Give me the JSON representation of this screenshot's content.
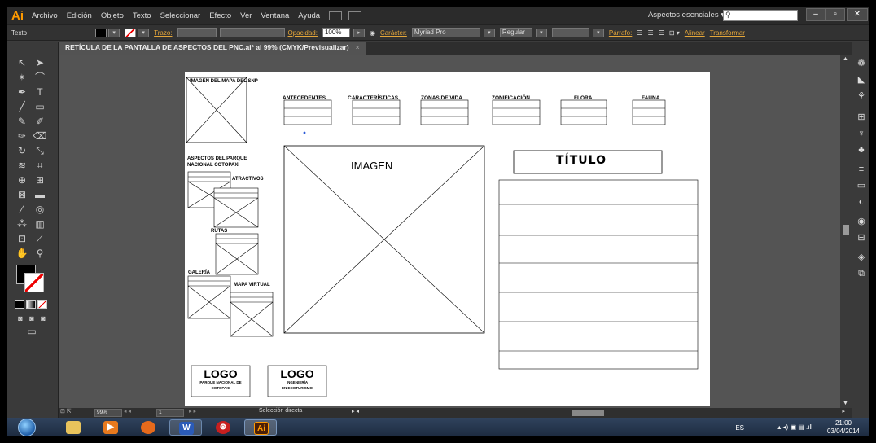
{
  "app": {
    "logo": "Ai",
    "menus": [
      "Archivo",
      "Edición",
      "Objeto",
      "Texto",
      "Seleccionar",
      "Efecto",
      "Ver",
      "Ventana",
      "Ayuda"
    ],
    "workspace": "Aspectos esenciales",
    "window_buttons": [
      "–",
      "▫",
      "✕"
    ]
  },
  "control_bar": {
    "tool_label": "Texto",
    "stroke_label": "Trazo:",
    "opacity_label": "Opacidad:",
    "opacity_value": "100%",
    "character_label": "Carácter:",
    "font_name": "Myriad Pro",
    "font_style": "Regular",
    "paragraph_label": "Párrafo:",
    "align_label": "Alinear",
    "transform_label": "Transformar"
  },
  "document": {
    "tab_title": "RETÍCULA DE LA PANTALLA DE ASPECTOS DEL PNC.ai* al 99% (CMYK/Previsualizar)",
    "tab_close": "×"
  },
  "artboard": {
    "map_label": "IMAGEN DEL MAPA DEL SNP",
    "nav": [
      "ANTECEDENTES",
      "CARACTERÍSTICAS",
      "ZONAS DE VIDA",
      "ZONIFICACIÓN",
      "FLORA",
      "FAUNA"
    ],
    "aspects_title_line1": "ASPECTOS DEL PARQUE",
    "aspects_title_line2": "NACIONAL COTOPAXI",
    "atractivos": "ATRACTIVOS",
    "rutas": "RUTAS",
    "galeria": "GALERÍA",
    "mapa_virtual": "MAPA VIRTUAL",
    "main_image": "IMAGEN",
    "title": "TÍTULO",
    "logo1": {
      "word": "LOGO",
      "line1": "PARQUE NACIONAL DE",
      "line2": "COTOPAXI"
    },
    "logo2": {
      "word": "LOGO",
      "line1": "INGENIERÍA",
      "line2": "EN ECOTURISMO"
    }
  },
  "status_bar": {
    "zoom": "99%",
    "page": "1",
    "tool_status": "Selección directa"
  },
  "taskbar": {
    "language": "ES",
    "time": "21:00",
    "date": "03/04/2014",
    "word_icon": "W",
    "ai_icon": "Ai"
  },
  "colors": {
    "accent_orange": "#ff9a00",
    "link_orange": "#e4a63a",
    "panel_bg": "#3c3c3c",
    "canvas_bg": "#545454"
  }
}
